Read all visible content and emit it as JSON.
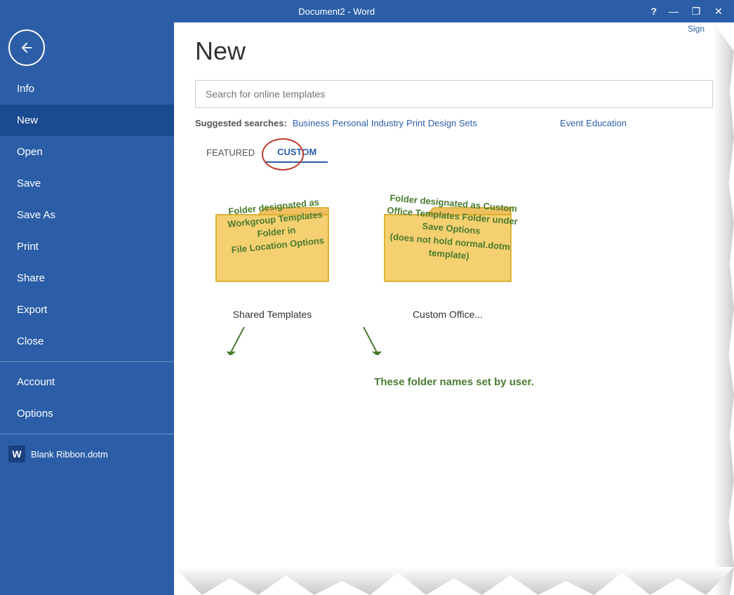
{
  "titlebar": {
    "title": "Document2 - Word",
    "help": "?",
    "minimize": "—",
    "maximize": "❐",
    "close": "✕",
    "sign_in": "Sign"
  },
  "sidebar": {
    "back_icon": "←",
    "items": [
      {
        "id": "info",
        "label": "Info",
        "active": false
      },
      {
        "id": "new",
        "label": "New",
        "active": true
      },
      {
        "id": "open",
        "label": "Open",
        "active": false
      },
      {
        "id": "save",
        "label": "Save",
        "active": false
      },
      {
        "id": "save-as",
        "label": "Save As",
        "active": false
      },
      {
        "id": "print",
        "label": "Print",
        "active": false
      },
      {
        "id": "share",
        "label": "Share",
        "active": false
      },
      {
        "id": "export",
        "label": "Export",
        "active": false
      },
      {
        "id": "close",
        "label": "Close",
        "active": false
      }
    ],
    "bottom_items": [
      {
        "id": "account",
        "label": "Account"
      },
      {
        "id": "options",
        "label": "Options"
      }
    ],
    "template_label": "Blank Ribbon.dotm"
  },
  "content": {
    "title": "New",
    "search_placeholder": "Search for online templates",
    "suggested_label": "Suggested searches:",
    "suggested_links": [
      "Business",
      "Personal",
      "Industry",
      "Print",
      "Design Sets",
      "Event",
      "Education"
    ],
    "tabs": [
      {
        "id": "featured",
        "label": "FEATURED"
      },
      {
        "id": "custom",
        "label": "CUSTOM"
      }
    ],
    "folders": [
      {
        "name": "Shared Templates",
        "annotation": "Folder designated as\nWorkgroup Templates Folder in\nFile Location Options"
      },
      {
        "name": "Custom Office...",
        "annotation": "Folder designated as Custom\nOffice Templates Folder under\nSave Options\n(does not hold normal.dotm\ntemplate)"
      }
    ],
    "bottom_annotation": "These folder names set by user."
  }
}
